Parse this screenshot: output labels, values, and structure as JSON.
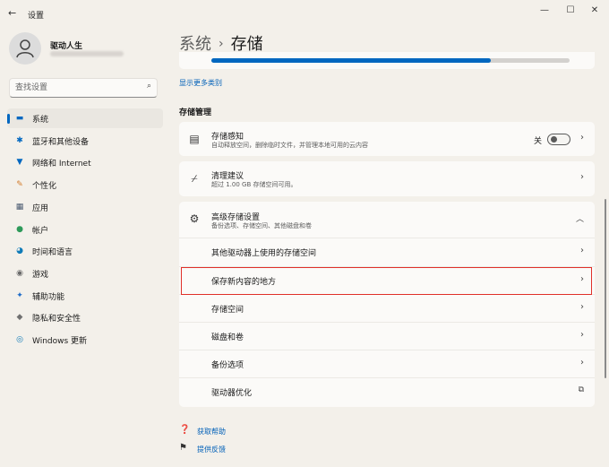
{
  "window": {
    "title": "设置",
    "controls": {
      "minimize": "—",
      "maximize": "☐",
      "close": "✕"
    }
  },
  "user": {
    "name": "驱动人生"
  },
  "search": {
    "placeholder": "查找设置"
  },
  "nav": [
    {
      "label": "系统",
      "icon": "monitor-icon",
      "glyph": "▬",
      "color": "#0067c0",
      "active": true
    },
    {
      "label": "蓝牙和其他设备",
      "icon": "bluetooth-icon",
      "glyph": "✱",
      "color": "#0067c0"
    },
    {
      "label": "网络和 Internet",
      "icon": "wifi-icon",
      "glyph": "▼",
      "color": "#0067c0"
    },
    {
      "label": "个性化",
      "icon": "brush-icon",
      "glyph": "✎",
      "color": "#d27b2b"
    },
    {
      "label": "应用",
      "icon": "apps-icon",
      "glyph": "▦",
      "color": "#4a5a70"
    },
    {
      "label": "帐户",
      "icon": "account-icon",
      "glyph": "●",
      "color": "#2e9a5a"
    },
    {
      "label": "时间和语言",
      "icon": "clock-globe-icon",
      "glyph": "◕",
      "color": "#0f7bb8"
    },
    {
      "label": "游戏",
      "icon": "gamepad-icon",
      "glyph": "◉",
      "color": "#6a6a6a"
    },
    {
      "label": "辅助功能",
      "icon": "accessibility-icon",
      "glyph": "✦",
      "color": "#1e6cc8"
    },
    {
      "label": "隐私和安全性",
      "icon": "shield-icon",
      "glyph": "◆",
      "color": "#707070"
    },
    {
      "label": "Windows 更新",
      "icon": "update-icon",
      "glyph": "◎",
      "color": "#0f7bb8"
    }
  ],
  "breadcrumb": {
    "parent": "系统",
    "separator": "›",
    "current": "存储"
  },
  "storage": {
    "usage_fraction": 0.78
  },
  "show_more": "显示更多类别",
  "section_title": "存储管理",
  "cards": {
    "storage_sense": {
      "title": "存储感知",
      "subtitle": "自动释放空间，删除临时文件，并管理本地可用的云内容",
      "toggle_label": "关",
      "toggle_on": false
    },
    "cleanup": {
      "title": "清理建议",
      "subtitle": "超过 1.00 GB 存储空间可用。"
    },
    "advanced": {
      "title": "高级存储设置",
      "subtitle": "备份选项、存储空间、其他磁盘和卷",
      "rows": [
        "其他驱动器上使用的存储空间",
        "保存新内容的地方",
        "存储空间",
        "磁盘和卷",
        "备份选项",
        "驱动器优化"
      ]
    }
  },
  "help": {
    "get_help": "获取帮助",
    "feedback": "提供反馈"
  },
  "colors": {
    "accent": "#0067c0",
    "highlight_border": "#e0302a"
  }
}
